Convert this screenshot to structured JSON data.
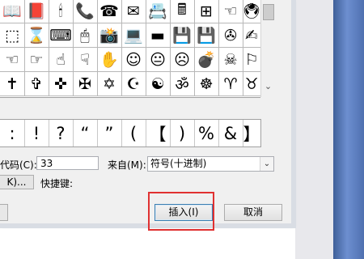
{
  "symbol_grid": {
    "rows": [
      [
        "📖",
        "📕",
        "🕯",
        "📞",
        "☎",
        "✉",
        "📇",
        "🖩",
        "⊞",
        "☜",
        "🖲"
      ],
      [
        "⬚",
        "⌛",
        "⌨",
        "🖱",
        "📸",
        "💻",
        "▬",
        "💾",
        "💾",
        "✇",
        "✍"
      ],
      [
        "☜",
        "☞",
        "☝",
        "☟",
        "✋",
        "☺",
        "😐",
        "☹",
        "💣",
        "☠",
        "⚐"
      ],
      [
        "✝",
        "✞",
        "✜",
        "✠",
        "✡",
        "☪",
        "☯",
        "ॐ",
        "☸",
        "♈",
        "♉"
      ]
    ]
  },
  "recent_symbols": [
    ":",
    "!",
    "?",
    "“",
    "”",
    "(",
    "【",
    ")",
    "%",
    "&",
    "】"
  ],
  "charcode": {
    "label": "代码(C):",
    "value": "33"
  },
  "from": {
    "label": "来自(M):",
    "value": "符号(十进制)"
  },
  "shortcut": {
    "button_label": "K)...",
    "label": "快捷键:"
  },
  "buttons": {
    "insert": "插入(I)",
    "cancel": "取消"
  },
  "colors": {
    "highlight": "#e03131",
    "default_button_border": "#3c7fb1"
  }
}
